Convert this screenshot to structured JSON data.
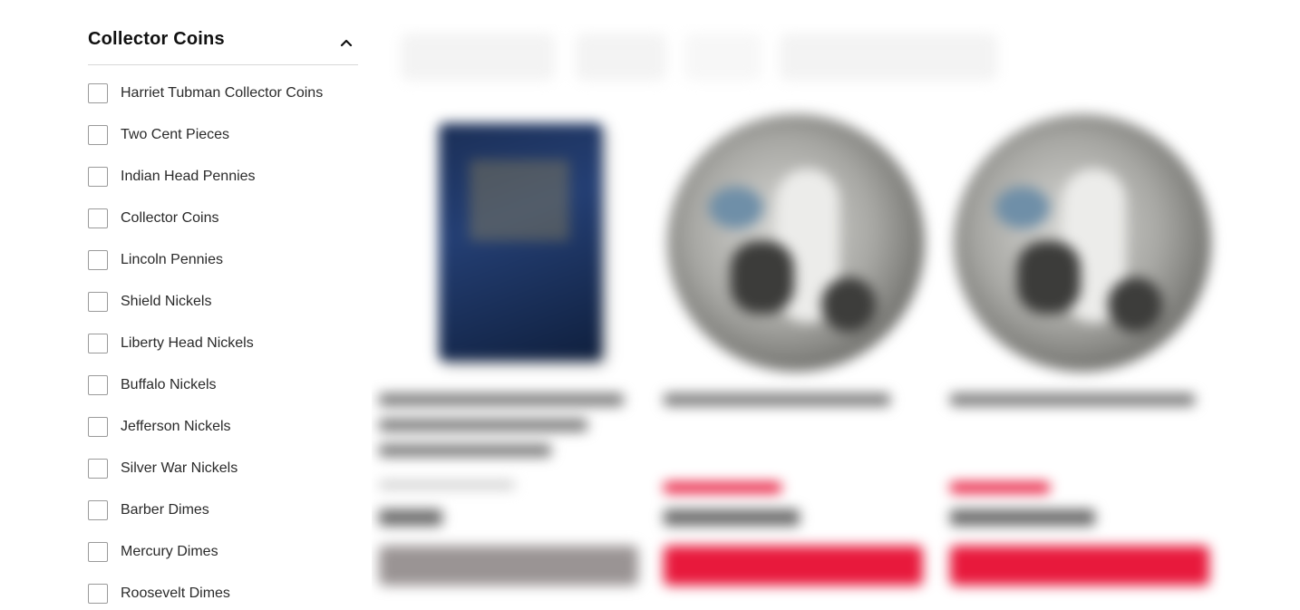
{
  "filter": {
    "title": "Collector Coins",
    "toggle_icon": "chevron-up-icon",
    "options": [
      {
        "label": "Harriet Tubman Collector Coins",
        "checked": false
      },
      {
        "label": "Two Cent Pieces",
        "checked": false
      },
      {
        "label": "Indian Head Pennies",
        "checked": false
      },
      {
        "label": "Collector Coins",
        "checked": false
      },
      {
        "label": "Lincoln Pennies",
        "checked": false
      },
      {
        "label": "Shield Nickels",
        "checked": false
      },
      {
        "label": "Liberty Head Nickels",
        "checked": false
      },
      {
        "label": "Buffalo Nickels",
        "checked": false
      },
      {
        "label": "Jefferson Nickels",
        "checked": false
      },
      {
        "label": "Silver War Nickels",
        "checked": false
      },
      {
        "label": "Barber Dimes",
        "checked": false
      },
      {
        "label": "Mercury Dimes",
        "checked": false
      },
      {
        "label": "Roosevelt Dimes",
        "checked": false
      }
    ]
  },
  "colors": {
    "accent_red": "#e8193c",
    "disabled_gray": "#9a9494",
    "checkbox_border": "#9a9a9a"
  }
}
